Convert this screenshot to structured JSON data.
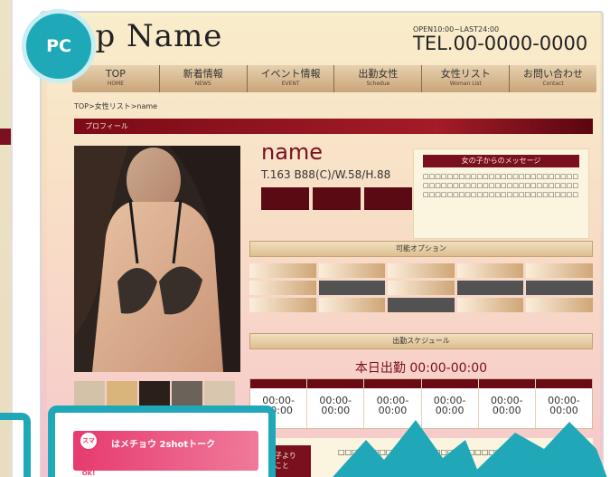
{
  "header": {
    "shop_name": "op Name",
    "hours": "OPEN10:00~LAST24:00",
    "tel": "TEL.00-0000-0000"
  },
  "nav": [
    {
      "label": "TOP",
      "sub": "HOME"
    },
    {
      "label": "新着情報",
      "sub": "NEWS"
    },
    {
      "label": "イベント情報",
      "sub": "EVENT"
    },
    {
      "label": "出勤女性",
      "sub": "Schedue"
    },
    {
      "label": "女性リスト",
      "sub": "Woman List"
    },
    {
      "label": "お問い合わせ",
      "sub": "Contact"
    }
  ],
  "breadcrumb": "TOP>女性リスト>name",
  "section_title": "プロフィール",
  "profile": {
    "name": "name",
    "size": "T.163 B88(C)/W.58/H.88"
  },
  "message": {
    "title": "女の子からのメッセージ",
    "text": "□□□□□□□□□□□□□□□□□□□□□□□□□□□□□□□□□□□□□□□□□□□□□□□□□□□□□□□□□□□□□□□□□□□□□□□□□□□□□□"
  },
  "options_title": "可能オプション",
  "schedule": {
    "title": "出勤スケジュール",
    "today": "本日出勤 00:00-00:00",
    "times": [
      "00:00-\n00:00",
      "00:00-\n00:00",
      "00:00-\n00:00",
      "00:00-\n00:00",
      "00:00-\n00:00",
      "00:00-\n00:00"
    ]
  },
  "bottom": {
    "tag": "の子より\nとこと",
    "text": "□□□□□□□□□□□□□□□□□□□□□□□□□□□□□□□□□□"
  },
  "overlay": {
    "pc_badge": "PC",
    "ok_label": "スマホOK!",
    "banner_text": "はメチョウ 2shotトーク"
  },
  "colors": {
    "accent": "#7a0f1e",
    "badge": "#1ea8b8"
  }
}
